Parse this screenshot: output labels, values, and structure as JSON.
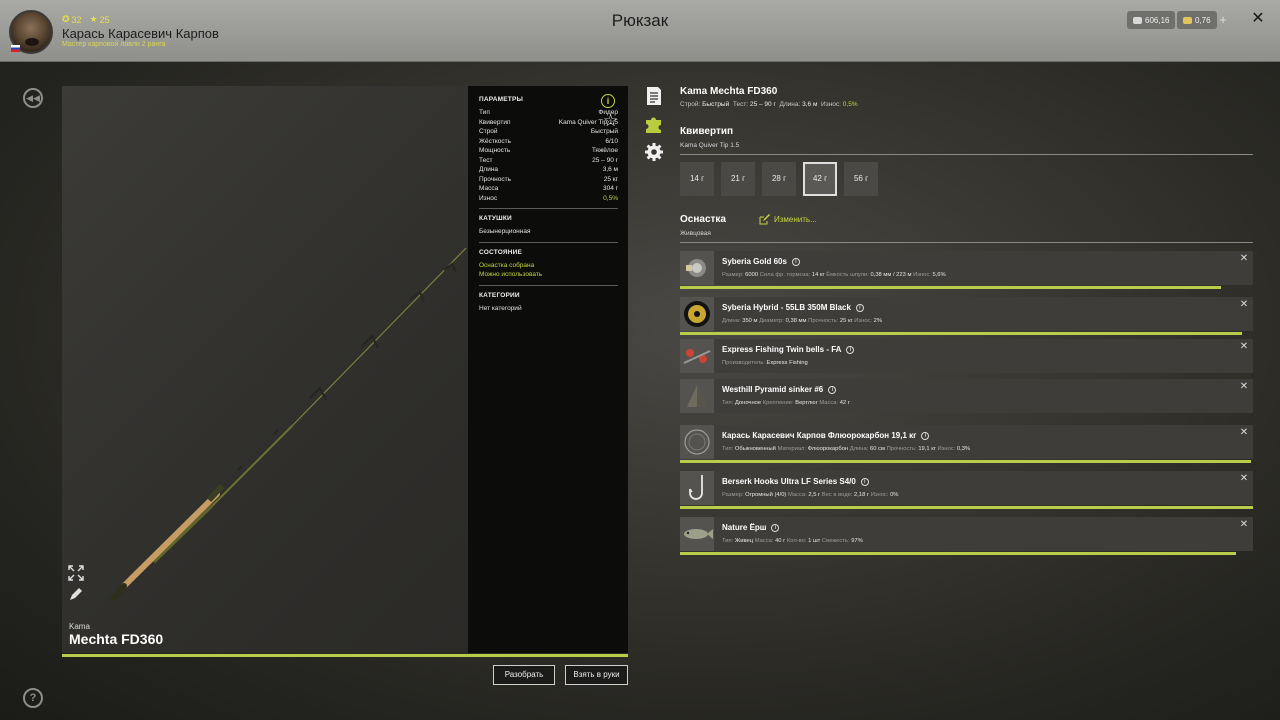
{
  "header": {
    "title": "Рюкзак",
    "player": {
      "level_stat": "32",
      "rank_stat": "25",
      "name": "Карась Карасевич Карпов",
      "rank": "Мастер карповой ловли 2 ранга"
    },
    "currency": {
      "silver": "606,16",
      "gold": "0,76"
    }
  },
  "item": {
    "brand": "Kama",
    "model": "Mechta FD360",
    "full_title": "Kama Mechta FD360",
    "sub": {
      "action_label": "Строй:",
      "action_value": "Быстрый",
      "test_label": "Тест:",
      "test_value": "25 – 90 г",
      "length_label": "Длина:",
      "length_value": "3,6 м",
      "wear_label": "Износ:",
      "wear_value": "0,5%"
    },
    "wear_percent": 100
  },
  "params": {
    "heading": "ПАРАМЕТРЫ",
    "rows": [
      {
        "k": "Тип",
        "v": "Фидер"
      },
      {
        "k": "Квивертип",
        "v": "Kama Quiver Tip 1.5"
      },
      {
        "k": "Строй",
        "v": "Быстрый"
      },
      {
        "k": "Жёсткость",
        "v": "6/10"
      },
      {
        "k": "Мощность",
        "v": "Тяжёлое"
      },
      {
        "k": "Тест",
        "v": "25 – 90 г"
      },
      {
        "k": "Длина",
        "v": "3,6 м"
      },
      {
        "k": "Прочность",
        "v": "25 кг"
      },
      {
        "k": "Масса",
        "v": "304 г"
      },
      {
        "k": "Износ",
        "v": "0,5%"
      }
    ],
    "reels_heading": "КАТУШКИ",
    "reels_value": "Безынерционная",
    "state_heading": "СОСТОЯНИЕ",
    "state_1": "Оснастка собрана",
    "state_2": "Можно использовать",
    "categories_heading": "КАТЕГОРИИ",
    "categories_value": "Нет категорий"
  },
  "buttons": {
    "disassemble": "Разобрать",
    "take": "Взять в руки"
  },
  "quivertip": {
    "title": "Квивертип",
    "sub": "Kama Quiver Tip 1.5",
    "options": [
      "14 г",
      "21 г",
      "28 г",
      "42 г",
      "56 г"
    ],
    "selected": "42 г"
  },
  "rig": {
    "title": "Оснастка",
    "change": "Изменить...",
    "sub": "Живцовая"
  },
  "tackle": [
    {
      "name": "Syberia Gold 60s",
      "attrs": [
        [
          "Размер:",
          "6000"
        ],
        [
          "Сила фр. тормоза:",
          "14 кг"
        ],
        [
          "Ёмкость шпули:",
          "0,38 мм / 223 м"
        ],
        [
          "Износ:",
          "5,6%"
        ]
      ],
      "wear": 0.944,
      "icon": "reel-icon"
    },
    {
      "name": "Syberia Hybrid - 55LB 350M Black",
      "attrs": [
        [
          "Длина:",
          "350 м"
        ],
        [
          "Диаметр:",
          "0,38 мм"
        ],
        [
          "Прочность:",
          "25 кг"
        ],
        [
          "Износ:",
          "2%"
        ]
      ],
      "wear": 0.98,
      "icon": "line-spool-icon"
    },
    {
      "name": "Express Fishing Twin bells - FA",
      "attrs": [
        [
          "Производитель:",
          "Express Fishing"
        ]
      ],
      "wear": null,
      "icon": "bells-icon"
    },
    {
      "name": "Westhill Pyramid sinker #6",
      "attrs": [
        [
          "Тип:",
          "Доночное"
        ],
        [
          "Крепление:",
          "Вертлюг"
        ],
        [
          "Масса:",
          "42 г"
        ]
      ],
      "wear": null,
      "icon": "sinker-icon"
    },
    {
      "name": "Карась Карасевич Карпов Флюорокарбон 19,1 кг",
      "attrs": [
        [
          "Тип:",
          "Обыкновенный"
        ],
        [
          "Материал:",
          "Флюорокарбон"
        ],
        [
          "Длина:",
          "60 см"
        ],
        [
          "Прочность:",
          "19,1 кг"
        ],
        [
          "Износ:",
          "0,3%"
        ]
      ],
      "wear": 0.997,
      "icon": "leader-icon"
    },
    {
      "name": "Berserk Hooks Ultra LF Series S4/0",
      "attrs": [
        [
          "Размер:",
          "Огромный (4/0)"
        ],
        [
          "Масса:",
          "2,5 г"
        ],
        [
          "Вес в воде:",
          "2,18 г"
        ],
        [
          "Износ:",
          "0%"
        ]
      ],
      "wear": 1,
      "icon": "hook-icon"
    },
    {
      "name": "Nature Ёрш",
      "attrs": [
        [
          "Тип:",
          "Живец"
        ],
        [
          "Масса:",
          "40 г"
        ],
        [
          "Кол-во:",
          "1 шт"
        ],
        [
          "Свежесть:",
          "97%"
        ]
      ],
      "wear": 0.97,
      "icon": "fish-bait-icon"
    }
  ]
}
